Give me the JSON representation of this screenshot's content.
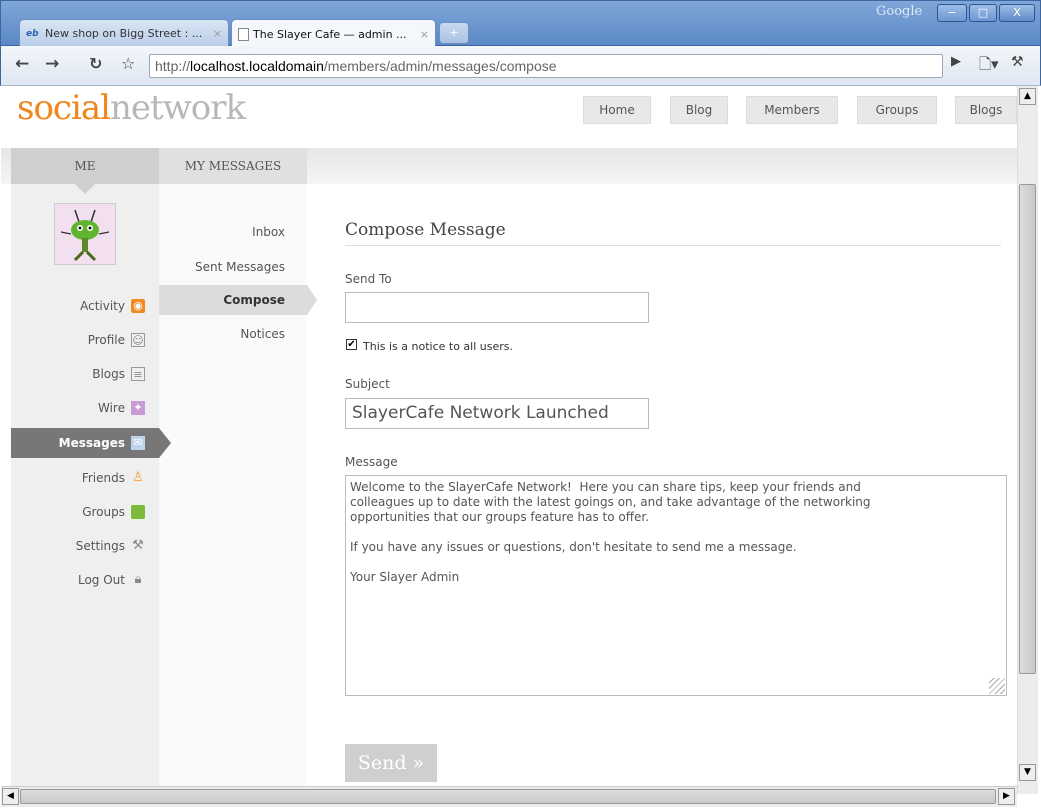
{
  "browser": {
    "google_label": "Google",
    "tabs": [
      {
        "title": "New shop on Bigg Street : ...",
        "close": "×",
        "active": false
      },
      {
        "title": "The Slayer Cafe — admin ...",
        "close": "×",
        "active": true
      }
    ],
    "new_tab": "+",
    "url": {
      "prefix": "http://",
      "host": "localhost.localdomain",
      "path": "/members/admin/messages/compose"
    },
    "window_buttons": {
      "minimize": "−",
      "maximize": "□",
      "close": "X"
    }
  },
  "site": {
    "logo": {
      "part1": "social",
      "part2": "network"
    },
    "nav": [
      "Home",
      "Blog",
      "Members",
      "Groups",
      "Blogs"
    ]
  },
  "sections": {
    "me": "ME",
    "my_messages": "MY MESSAGES"
  },
  "sidebar": {
    "items": [
      {
        "label": "Activity",
        "icon": "rss-icon"
      },
      {
        "label": "Profile",
        "icon": "profile-icon"
      },
      {
        "label": "Blogs",
        "icon": "blog-icon"
      },
      {
        "label": "Wire",
        "icon": "wire-icon"
      },
      {
        "label": "Messages",
        "icon": "envelope-icon",
        "active": true
      },
      {
        "label": "Friends",
        "icon": "friends-icon"
      },
      {
        "label": "Groups",
        "icon": "cube-icon"
      },
      {
        "label": "Settings",
        "icon": "wrench-icon"
      },
      {
        "label": "Log Out",
        "icon": "lock-icon"
      }
    ]
  },
  "submenu": {
    "items": [
      {
        "label": "Inbox"
      },
      {
        "label": "Sent Messages"
      },
      {
        "label": "Compose",
        "active": true
      },
      {
        "label": "Notices"
      }
    ]
  },
  "compose": {
    "title": "Compose Message",
    "send_to_label": "Send To",
    "send_to_value": "",
    "notice_checked": true,
    "notice_label": "This is a notice to all users.",
    "subject_label": "Subject",
    "subject_value": "SlayerCafe Network Launched",
    "message_label": "Message",
    "message_value": "Welcome to the SlayerCafe Network!  Here you can share tips, keep your friends and\ncolleagues up to date with the latest goings on, and take advantage of the networking\nopportunities that our groups feature has to offer.\n\nIf you have any issues or questions, don't hesitate to send me a message.\n\nYour Slayer Admin",
    "send_label": "Send »"
  },
  "colors": {
    "logo_accent": "#f0861c",
    "logo_muted": "#b7b7b7",
    "active_nav": "#777777"
  }
}
